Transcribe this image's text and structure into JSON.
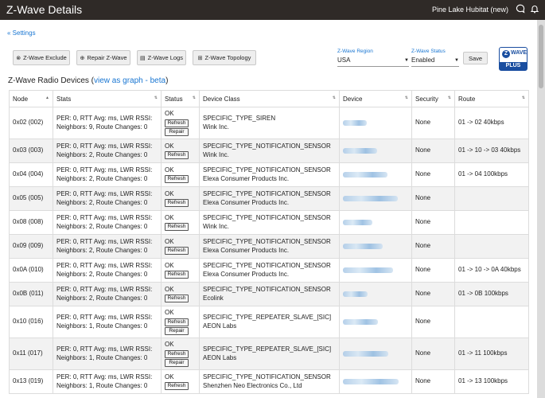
{
  "header": {
    "title": "Z-Wave Details",
    "hub_name": "Pine Lake Hubitat (new)"
  },
  "nav": {
    "back_label": "« Settings"
  },
  "toolbar": {
    "buttons": [
      {
        "label": "Z-Wave Exclude",
        "icon": "exclude-icon"
      },
      {
        "label": "Repair Z-Wave",
        "icon": "repair-icon"
      },
      {
        "label": "Z-Wave Logs",
        "icon": "logs-icon"
      },
      {
        "label": "Z-Wave Topology",
        "icon": "topology-icon"
      }
    ],
    "region_label": "Z-Wave Region",
    "region_value": "USA",
    "status_label": "Z-Wave Status",
    "status_value": "Enabled",
    "save_label": "Save"
  },
  "logo": {
    "wave_text": "WAVE",
    "plus_text": "PLUS",
    "z_text": "Z"
  },
  "section": {
    "title": "Z-Wave Radio Devices",
    "paren_open": "(",
    "link": "view as graph - beta",
    "paren_close": ")"
  },
  "table": {
    "columns": [
      "Node",
      "Stats",
      "Status",
      "Device Class",
      "Device",
      "Security",
      "Route"
    ],
    "refresh_label": "Refresh",
    "repair_label": "Repair",
    "rows": [
      {
        "node": "0x02 (002)",
        "stats1": "PER: 0, RTT Avg: ms, LWR RSSI:",
        "stats2": "Neighbors: 9, Route Changes: 0",
        "status": "OK",
        "repair": true,
        "class": "SPECIFIC_TYPE_SIREN",
        "maker": "Wink Inc.",
        "security": "None",
        "route": "01 -> 02 40kbps"
      },
      {
        "node": "0x03 (003)",
        "stats1": "PER: 0, RTT Avg: ms, LWR RSSI:",
        "stats2": "Neighbors: 2, Route Changes: 0",
        "status": "OK",
        "repair": false,
        "class": "SPECIFIC_TYPE_NOTIFICATION_SENSOR",
        "maker": "Wink Inc.",
        "security": "None",
        "route": "01 -> 10 -> 03 40kbps"
      },
      {
        "node": "0x04 (004)",
        "stats1": "PER: 0, RTT Avg: ms, LWR RSSI:",
        "stats2": "Neighbors: 2, Route Changes: 0",
        "status": "OK",
        "repair": false,
        "class": "SPECIFIC_TYPE_NOTIFICATION_SENSOR",
        "maker": "Elexa Consumer Products Inc.",
        "security": "None",
        "route": "01 -> 04 100kbps"
      },
      {
        "node": "0x05 (005)",
        "stats1": "PER: 0, RTT Avg: ms, LWR RSSI:",
        "stats2": "Neighbors: 2, Route Changes: 0",
        "status": "OK",
        "repair": false,
        "class": "SPECIFIC_TYPE_NOTIFICATION_SENSOR",
        "maker": "Elexa Consumer Products Inc.",
        "security": "None",
        "route": ""
      },
      {
        "node": "0x08 (008)",
        "stats1": "PER: 0, RTT Avg: ms, LWR RSSI:",
        "stats2": "Neighbors: 2, Route Changes: 0",
        "status": "OK",
        "repair": false,
        "class": "SPECIFIC_TYPE_NOTIFICATION_SENSOR",
        "maker": "Wink Inc.",
        "security": "None",
        "route": ""
      },
      {
        "node": "0x09 (009)",
        "stats1": "PER: 0, RTT Avg: ms, LWR RSSI:",
        "stats2": "Neighbors: 2, Route Changes: 0",
        "status": "OK",
        "repair": false,
        "class": "SPECIFIC_TYPE_NOTIFICATION_SENSOR",
        "maker": "Elexa Consumer Products Inc.",
        "security": "None",
        "route": ""
      },
      {
        "node": "0x0A (010)",
        "stats1": "PER: 0, RTT Avg: ms, LWR RSSI:",
        "stats2": "Neighbors: 2, Route Changes: 0",
        "status": "OK",
        "repair": false,
        "class": "SPECIFIC_TYPE_NOTIFICATION_SENSOR",
        "maker": "Elexa Consumer Products Inc.",
        "security": "None",
        "route": "01 -> 10 -> 0A 40kbps"
      },
      {
        "node": "0x0B (011)",
        "stats1": "PER: 0, RTT Avg: ms, LWR RSSI:",
        "stats2": "Neighbors: 2, Route Changes: 0",
        "status": "OK",
        "repair": false,
        "class": "SPECIFIC_TYPE_NOTIFICATION_SENSOR",
        "maker": "Ecolink",
        "security": "None",
        "route": "01 -> 0B 100kbps"
      },
      {
        "node": "0x10 (016)",
        "stats1": "PER: 0, RTT Avg: ms, LWR RSSI:",
        "stats2": "Neighbors: 1, Route Changes: 0",
        "status": "OK",
        "repair": true,
        "class": "SPECIFIC_TYPE_REPEATER_SLAVE_[SIC]",
        "maker": "AEON Labs",
        "security": "None",
        "route": ""
      },
      {
        "node": "0x11 (017)",
        "stats1": "PER: 0, RTT Avg: ms, LWR RSSI:",
        "stats2": "Neighbors: 1, Route Changes: 0",
        "status": "OK",
        "repair": true,
        "class": "SPECIFIC_TYPE_REPEATER_SLAVE_[SIC]",
        "maker": "AEON Labs",
        "security": "None",
        "route": "01 -> 11 100kbps"
      },
      {
        "node": "0x13 (019)",
        "stats1": "PER: 0, RTT Avg: ms, LWR RSSI:",
        "stats2": "Neighbors: 1, Route Changes: 0",
        "status": "OK",
        "repair": false,
        "class": "SPECIFIC_TYPE_NOTIFICATION_SENSOR",
        "maker": "Shenzhen Neo Electronics Co., Ltd",
        "security": "None",
        "route": "01 -> 13 100kbps"
      }
    ]
  }
}
